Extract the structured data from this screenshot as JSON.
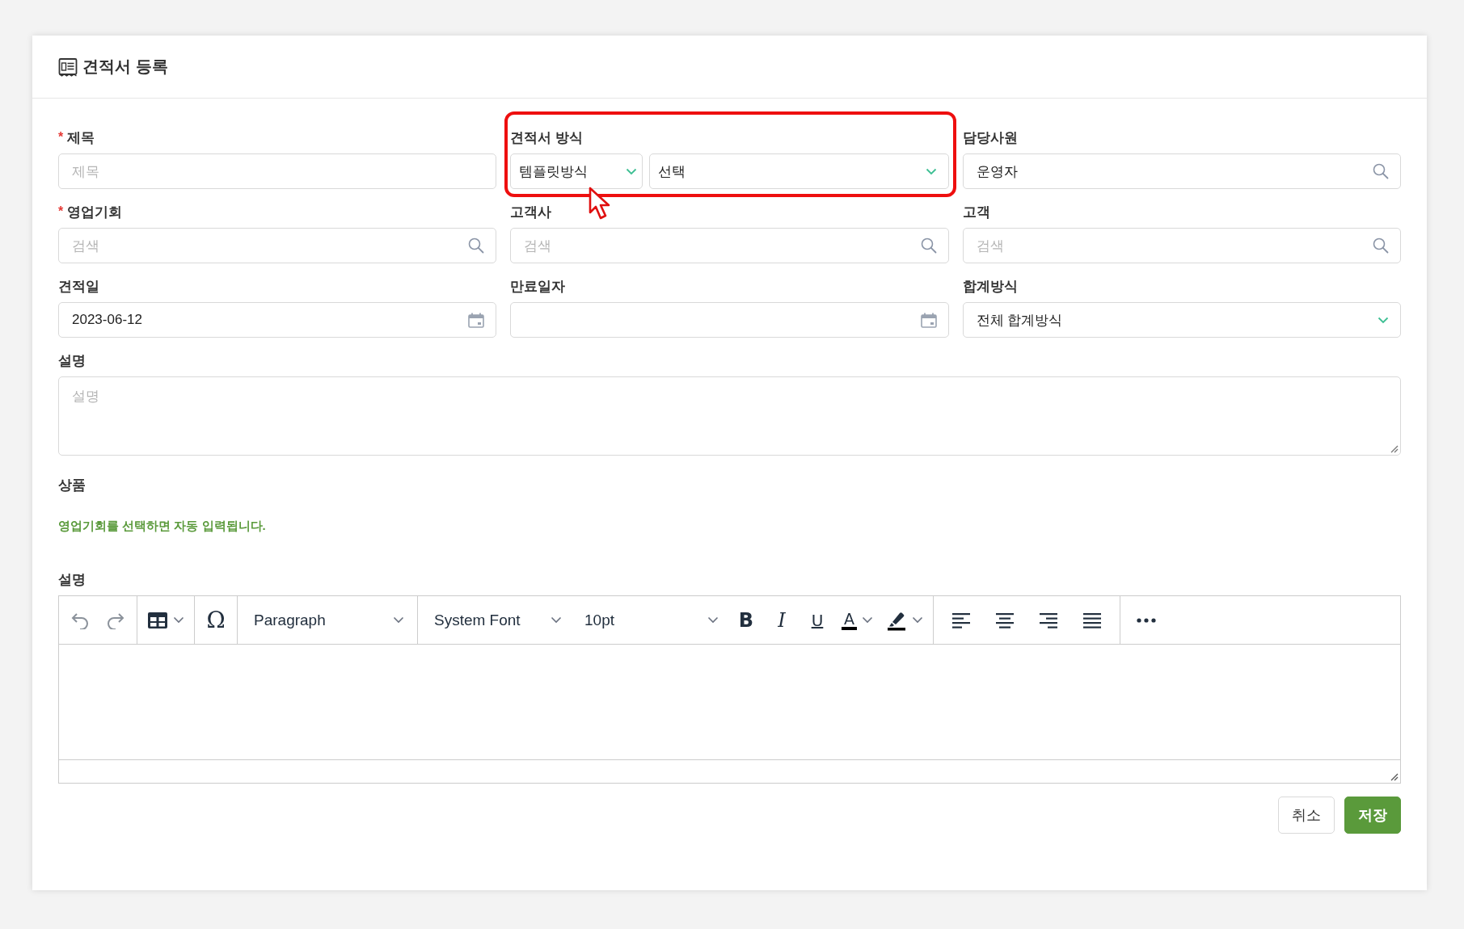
{
  "header": {
    "title": "견적서 등록"
  },
  "fields": [
    {
      "label": "제목",
      "required_mark": "*",
      "kind": "text",
      "placeholder": "제목"
    },
    {
      "label": "견적서 방식",
      "kind": "dual-select",
      "highlighted": true,
      "values": [
        "템플릿방식",
        "선택"
      ]
    },
    {
      "label": "담당사원",
      "kind": "search",
      "value": "운영자"
    },
    {
      "label": "영업기회",
      "required_mark": "*",
      "kind": "search",
      "placeholder": "검색"
    },
    {
      "label": "고객사",
      "kind": "search",
      "placeholder": "검색"
    },
    {
      "label": "고객",
      "kind": "search",
      "placeholder": "검색"
    },
    {
      "label": "견적일",
      "kind": "date",
      "value": "2023-06-12"
    },
    {
      "label": "만료일자",
      "kind": "date"
    },
    {
      "label": "합계방식",
      "kind": "select",
      "value": "전체 합계방식"
    }
  ],
  "description": {
    "label": "설명",
    "placeholder": "설명"
  },
  "products": {
    "label": "상품",
    "note": "영업기회를 선택하면 자동 입력됩니다."
  },
  "editor": {
    "label": "설명",
    "toolbar": [
      [
        {
          "kind": "undo"
        },
        {
          "kind": "redo"
        }
      ],
      [
        {
          "kind": "table"
        }
      ],
      [
        {
          "kind": "special-char",
          "text": "Ω"
        }
      ],
      [
        {
          "kind": "select",
          "value": "Paragraph"
        }
      ],
      [
        {
          "kind": "select",
          "value": "System Font"
        },
        {
          "kind": "select",
          "value": "10pt"
        },
        {
          "kind": "bold",
          "text": "B"
        },
        {
          "kind": "italic",
          "text": "I"
        },
        {
          "kind": "underline",
          "text": "U"
        },
        {
          "kind": "text-color",
          "text": "A"
        },
        {
          "kind": "highlight"
        }
      ],
      [
        {
          "kind": "align-left"
        },
        {
          "kind": "align-center"
        },
        {
          "kind": "align-right"
        },
        {
          "kind": "justify"
        }
      ],
      [
        {
          "kind": "more"
        }
      ]
    ]
  },
  "buttons": [
    {
      "label": "취소",
      "kind": "secondary"
    },
    {
      "label": "저장",
      "kind": "primary"
    }
  ]
}
